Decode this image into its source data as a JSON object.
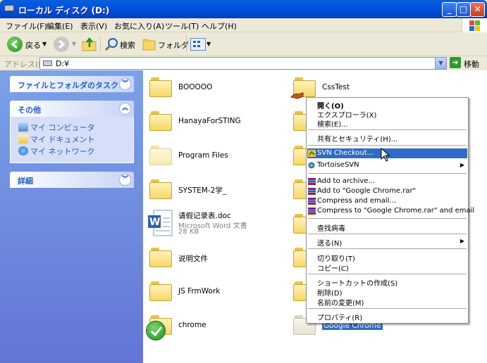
{
  "window": {
    "title": "ローカル ディスク (D:)"
  },
  "titlebar_buttons": {
    "minimize": "_",
    "maximize": "□",
    "close": "✕"
  },
  "menubar": [
    "ファイル(F)",
    "編集(E)",
    "表示(V)",
    "お気に入り(A)",
    "ツール(T)",
    "ヘルプ(H)"
  ],
  "toolbar": {
    "back": "戻る",
    "search": "検索",
    "folders": "フォルダ"
  },
  "address": {
    "label": "アドレス(D)",
    "value": "D:¥",
    "go": "移動"
  },
  "left_pane": {
    "tasks": {
      "title": "ファイルとフォルダのタスク"
    },
    "other": {
      "title": "その他",
      "links": [
        "マイ コンピュータ",
        "マイ ドキュメント",
        "マイ ネットワーク"
      ]
    },
    "details": {
      "title": "詳細"
    }
  },
  "files": {
    "col1": [
      "BOOOOO",
      "HanayaForSTING",
      "Program Files",
      "SYSTEM-2学_",
      "请假记录表.doc",
      "说明文件",
      "JS FrmWork",
      "chrome"
    ],
    "doc_type": "Microsoft Word 文書",
    "doc_size": "28 KB",
    "col2_top": "CssTest",
    "col2_bottom": "Google Chrome"
  },
  "context_menu": {
    "items": [
      "開く(O)",
      "エクスプローラ(X)",
      "検索(E)...",
      "共有とセキュリティ(H)...",
      "SVN Checkout...",
      "TortoiseSVN",
      "Add to archive...",
      "Add to \"Google Chrome.rar\"",
      "Compress and email...",
      "Compress to \"Google Chrome.rar\" and email",
      "查找病毒",
      "送る(N)",
      "切り取り(T)",
      "コピー(C)",
      "ショートカットの作成(S)",
      "削除(D)",
      "名前の変更(M)",
      "プロパティ(R)"
    ],
    "selected": "SVN Checkout...",
    "colors": {
      "highlight": "#316ac5"
    }
  }
}
